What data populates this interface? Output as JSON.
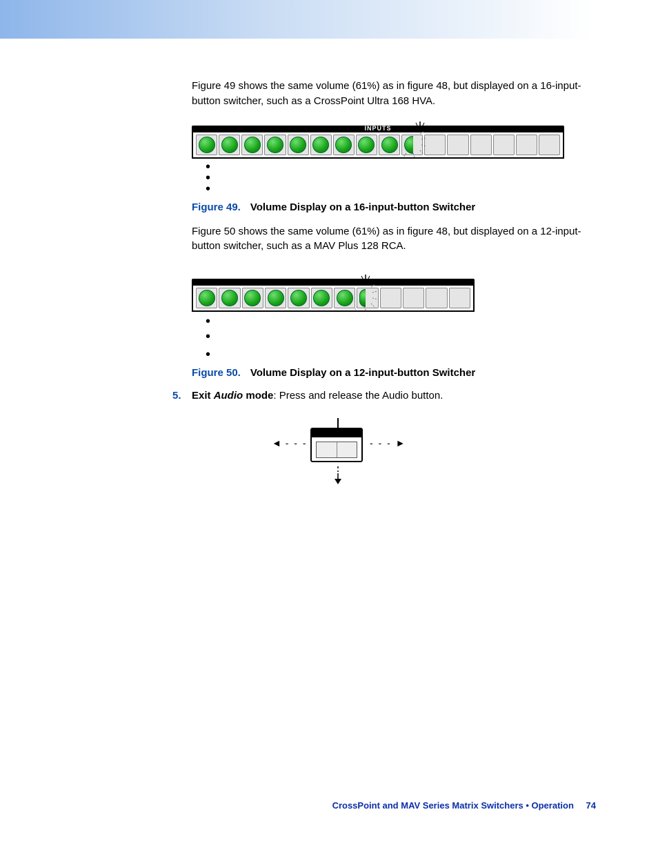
{
  "para1": "Figure 49 shows the same volume (61%) as in figure 48, but displayed on a 16-input-button switcher, such as a CrossPoint Ultra 168 HVA.",
  "fig49": {
    "num": "Figure 49.",
    "title": "Volume Display on a 16-input-button Switcher"
  },
  "panel16_label": "INPUTS",
  "para2": "Figure 50 shows the same volume (61%) as in figure 48, but displayed on a 12-input-button switcher, such as a MAV Plus 128 RCA.",
  "fig50": {
    "num": "Figure 50.",
    "title": "Volume Display on a 12-input-button Switcher"
  },
  "step": {
    "num": "5.",
    "bold1": "Exit ",
    "italic": "Audio",
    "bold2": " mode",
    "rest": ": Press and release the Audio button."
  },
  "footer": {
    "title": "CrossPoint and MAV Series Matrix Switchers • Operation",
    "page": "74"
  },
  "vol_percent": 61,
  "panel16_full": 9,
  "panel16_partial": "half",
  "panel16_total": 16,
  "panel12_full": 7,
  "panel12_partial": "third",
  "panel12_total": 12
}
